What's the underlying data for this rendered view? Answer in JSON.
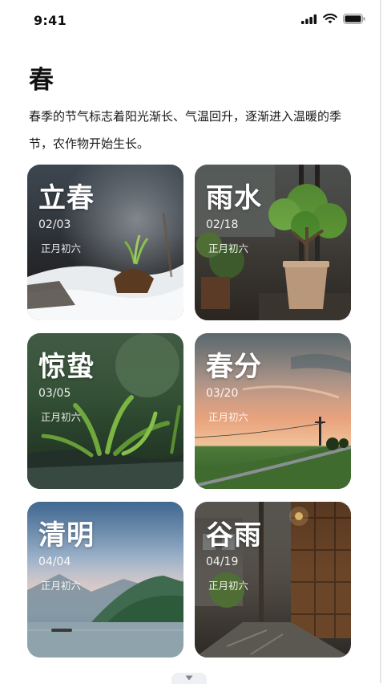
{
  "status_bar": {
    "time": "9:41"
  },
  "page": {
    "title": "春",
    "description": "春季的节气标志着阳光渐长、气温回升，逐渐进入温暖的季节，农作物开始生长。"
  },
  "solar_terms": [
    {
      "name": "立春",
      "date": "02/03",
      "lunar": "正月初六",
      "scene": "snow-sprout"
    },
    {
      "name": "雨水",
      "date": "02/18",
      "lunar": "正月初六",
      "scene": "potted-tree-rain"
    },
    {
      "name": "惊蛰",
      "date": "03/05",
      "lunar": "正月初六",
      "scene": "grass-water"
    },
    {
      "name": "春分",
      "date": "03/20",
      "lunar": "正月初六",
      "scene": "sunset-field"
    },
    {
      "name": "清明",
      "date": "04/04",
      "lunar": "正月初六",
      "scene": "misty-lake-mountains"
    },
    {
      "name": "谷雨",
      "date": "04/19",
      "lunar": "正月初六",
      "scene": "rainy-alley"
    }
  ]
}
